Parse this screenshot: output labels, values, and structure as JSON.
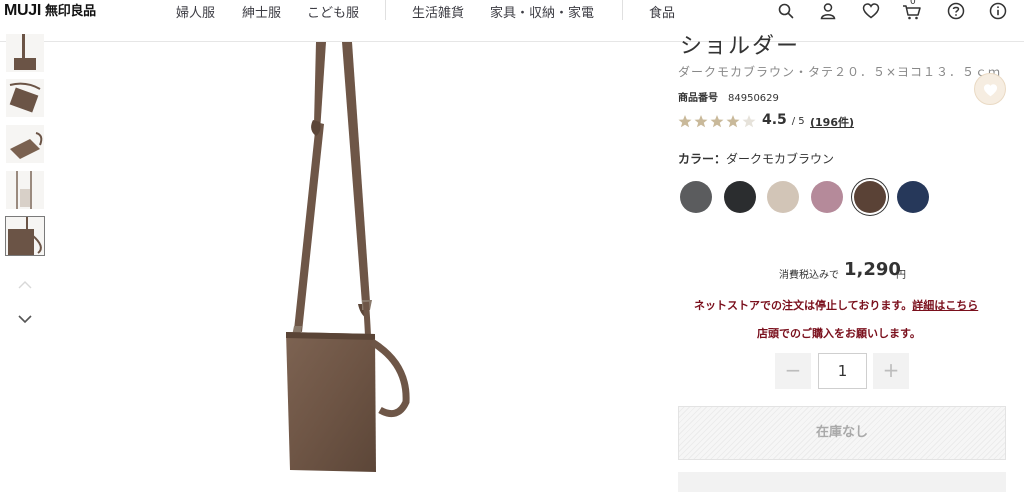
{
  "header": {
    "logo_en": "MUJI",
    "logo_jp": "無印良品",
    "nav": [
      "婦人服",
      "紳士服",
      "こども服",
      "生活雑貨",
      "家具・収納・家電",
      "食品"
    ],
    "cart_count": "0",
    "icons": [
      "search-icon",
      "user-icon",
      "heart-icon",
      "cart-icon",
      "help-icon",
      "info-icon"
    ]
  },
  "product": {
    "title_partial": "ショルダー",
    "subtitle": "ダークモカブラウン・タテ２０．５×ヨコ１３．５ｃｍ",
    "number_label": "商品番号",
    "number": "84950629",
    "rating": "4.5",
    "rating_max": "/ 5",
    "rating_value": 4.5,
    "reviews": "(196件)",
    "color_label": "カラー：",
    "color_name": "ダークモカブラウン",
    "swatches": [
      {
        "name": "gray",
        "color": "#5b5c5e"
      },
      {
        "name": "black",
        "color": "#2b2d2f"
      },
      {
        "name": "beige",
        "color": "#d2c5b7"
      },
      {
        "name": "pink",
        "color": "#b58a9a"
      },
      {
        "name": "dark-mocha-brown",
        "color": "#5a4236",
        "selected": true
      },
      {
        "name": "navy",
        "color": "#26385a"
      }
    ],
    "price_label": "消費税込みで",
    "price": "1,290",
    "currency": "円",
    "notice_line1": "ネットストアでの注文は停止しております。",
    "notice_link": "詳細はこちら",
    "notice_line2": "店頭でのご購入をお願いします。",
    "quantity": "1",
    "minus": "−",
    "plus": "+",
    "stock_label": "在庫なし"
  },
  "colors": {
    "accent_red": "#7a0f1c",
    "bag_brown": "#6b5446",
    "star": "#c9b99a"
  }
}
